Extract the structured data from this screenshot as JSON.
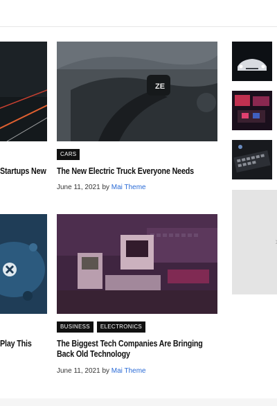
{
  "articles": [
    {
      "title": "The New Electric Truck Everyone Needs",
      "tags": [
        "CARS"
      ],
      "date": "June 11, 2021",
      "by": "by",
      "author": "Mai Theme"
    },
    {
      "title": "The Biggest Tech Companies Are Bringing Back Old Technology",
      "tags": [
        "BUSINESS",
        "ELECTRONICS"
      ],
      "date": "June 11, 2021",
      "by": "by",
      "author": "Mai Theme"
    }
  ],
  "partial_titles": {
    "top_left": "Startups New",
    "bottom_left": "Play This"
  },
  "sidebar": {
    "ad_chevron": "›"
  }
}
